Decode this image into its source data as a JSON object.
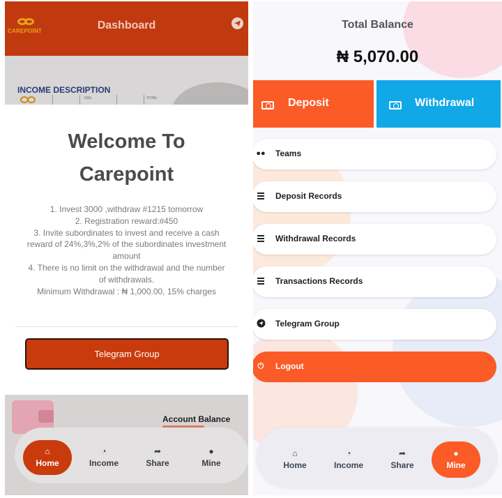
{
  "left": {
    "header": {
      "logo_text": "CAREPOINT",
      "title": "Dashboard",
      "send_icon": "telegram-send-icon"
    },
    "income": {
      "title": "INCOME DESCRIPTION",
      "col_1": "DAIL",
      "col_2": "TOTAL"
    },
    "modal": {
      "welcome_line_1": "Welcome To",
      "welcome_line_2": "Carepoint",
      "rules": [
        "1. Invest 3000 ,withdraw #1215 tomorrow",
        "2. Registration reward:#450",
        "3. Invite subordinates to invest and receive a cash reward of 24%,3%,2% of the subordinates investment amount",
        "4. There is no limit on the withdrawal and the number of withdrawals.",
        "Minimum Withdrawal : ₦ 1,000.00, 15% charges"
      ],
      "telegram_button": "Telegram Group"
    },
    "account": {
      "label": "Account Balance"
    },
    "nav": [
      {
        "label": "Home",
        "icon": "home-icon",
        "active": true
      },
      {
        "label": "Income",
        "icon": "pie-chart-icon",
        "active": false
      },
      {
        "label": "Share",
        "icon": "share-icon",
        "active": false
      },
      {
        "label": "Mine",
        "icon": "user-icon",
        "active": false
      }
    ]
  },
  "right": {
    "balance": {
      "title": "Total Balance",
      "value": "₦ 5,070.00"
    },
    "actions": {
      "deposit": "Deposit",
      "withdrawal": "Withdrawal"
    },
    "menu": [
      {
        "label": "Teams",
        "icon": "users-icon"
      },
      {
        "label": "Deposit Records",
        "icon": "list-icon"
      },
      {
        "label": "Withdrawal Records",
        "icon": "list-icon"
      },
      {
        "label": "Transactions Records",
        "icon": "list-icon"
      },
      {
        "label": "Telegram Group",
        "icon": "telegram-icon"
      },
      {
        "label": "Logout",
        "icon": "power-icon"
      }
    ],
    "nav": [
      {
        "label": "Home",
        "icon": "home-icon",
        "active": false
      },
      {
        "label": "Income",
        "icon": "pie-chart-icon",
        "active": false
      },
      {
        "label": "Share",
        "icon": "share-icon",
        "active": false
      },
      {
        "label": "Mine",
        "icon": "user-icon",
        "active": true
      }
    ]
  },
  "colors": {
    "header_red": "#c13a0f",
    "accent_orange": "#fb5b27",
    "withdraw_blue": "#11a8e8"
  }
}
